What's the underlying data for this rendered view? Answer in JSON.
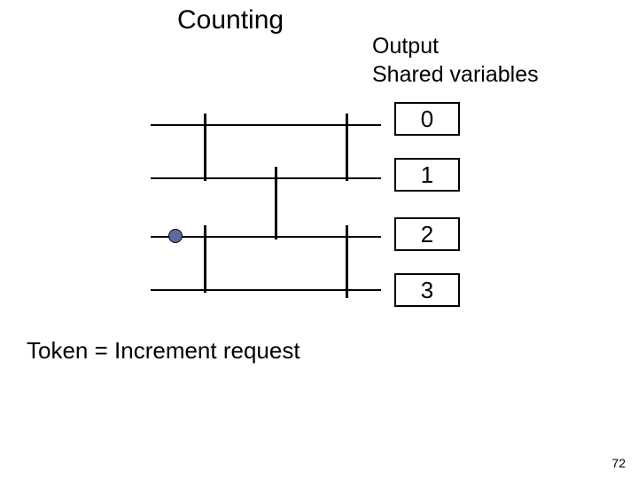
{
  "title": "Counting",
  "labels": {
    "output": "Output",
    "shared": "Shared variables",
    "token": "Token = Increment request"
  },
  "page_number": "72",
  "chart_data": {
    "type": "diagram",
    "title": "Counting",
    "annotations": [
      "Output",
      "Shared variables",
      "Token = Increment request"
    ],
    "shared_variable_boxes": [
      "0",
      "1",
      "2",
      "3"
    ],
    "wires": 4,
    "balancers_per_stage": [
      {
        "stage": 0,
        "pairs": [
          [
            0,
            1
          ],
          [
            2,
            3
          ]
        ]
      },
      {
        "stage": 1,
        "pairs": [
          [
            1,
            2
          ]
        ]
      },
      {
        "stage": 2,
        "pairs": [
          [
            0,
            1
          ],
          [
            2,
            3
          ]
        ]
      }
    ],
    "token_on_wire": 2
  },
  "boxes": {
    "b0": "0",
    "b1": "1",
    "b2": "2",
    "b3": "3"
  }
}
